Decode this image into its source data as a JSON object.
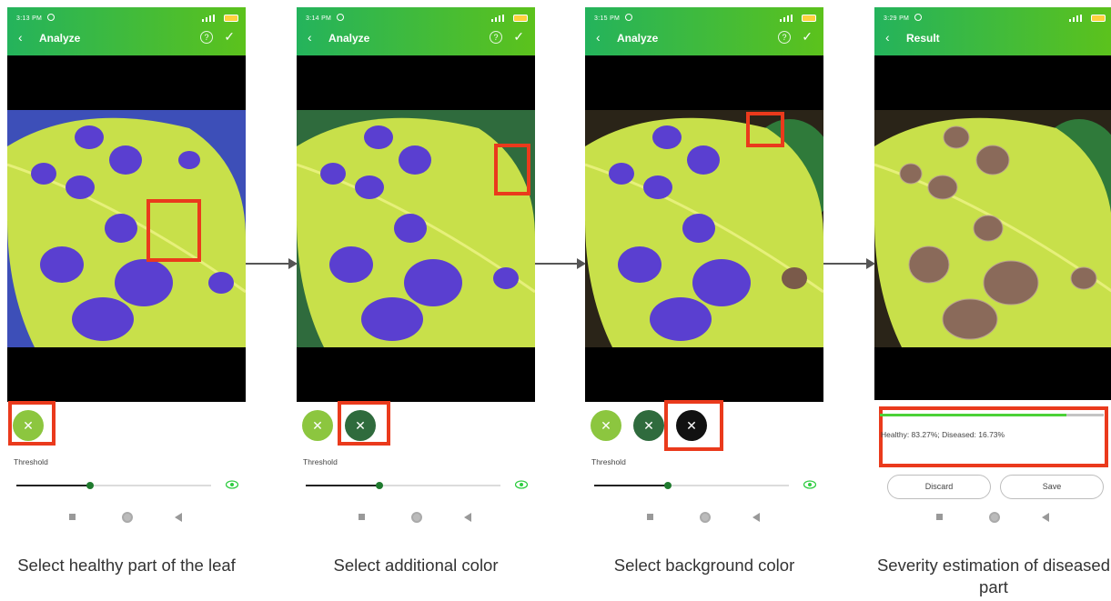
{
  "screens": [
    {
      "time": "3:13 PM",
      "title": "Analyze",
      "back_icon": "‹",
      "help_icon": "?",
      "confirm_icon": "✓",
      "threshold_label": "Threshold",
      "threshold_level": 0.38,
      "caption": "Select healthy part of the leaf",
      "color_buttons": [
        "#8cc63f"
      ]
    },
    {
      "time": "3:14 PM",
      "title": "Analyze",
      "back_icon": "‹",
      "help_icon": "?",
      "confirm_icon": "✓",
      "threshold_label": "Threshold",
      "threshold_level": 0.38,
      "caption": "Select additional color",
      "color_buttons": [
        "#8cc63f",
        "#2f6b3d"
      ]
    },
    {
      "time": "3:15 PM",
      "title": "Analyze",
      "back_icon": "‹",
      "help_icon": "?",
      "confirm_icon": "✓",
      "threshold_label": "Threshold",
      "threshold_level": 0.38,
      "caption": "Select background color",
      "color_buttons": [
        "#8cc63f",
        "#2f6b3d",
        "#111111"
      ]
    },
    {
      "time": "3:29 PM",
      "title": "Result",
      "back_icon": "‹",
      "result_text": "Healthy: 83.27%; Diseased: 16.73%",
      "healthy_fraction": 0.8327,
      "discard_label": "Discard",
      "save_label": "Save",
      "caption": "Severity estimation of diseased part"
    }
  ],
  "button_icon": "✕",
  "colors": {
    "header_start": "#24b35c",
    "header_end": "#5cc21c",
    "highlight": "#ea3a1c",
    "progress": "#4cd137",
    "disease_mask": "#5a3fd0",
    "disease_real": "#8a6a5a"
  }
}
